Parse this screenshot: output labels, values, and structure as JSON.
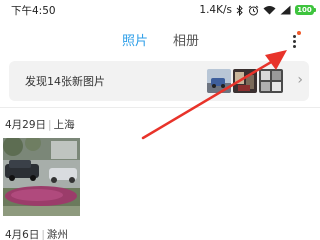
{
  "status_bar": {
    "time": "下午4:50",
    "network_speed": "1.4K/s",
    "battery": "100"
  },
  "header": {
    "tabs": [
      {
        "label": "照片",
        "active": true
      },
      {
        "label": "相册",
        "active": false
      }
    ],
    "accent_color": "#2f9fe8"
  },
  "banner": {
    "text": "发现14张新图片"
  },
  "sections": [
    {
      "date": "4月29日",
      "location": "上海"
    },
    {
      "date": "4月6日",
      "location": "滁州"
    }
  ],
  "annotation": {
    "arrow_color": "#e8332a"
  },
  "icons": [
    "bluetooth-icon",
    "alarm-icon",
    "wifi-icon",
    "signal-icon",
    "battery-icon",
    "more-icon",
    "chevron-right-icon"
  ]
}
